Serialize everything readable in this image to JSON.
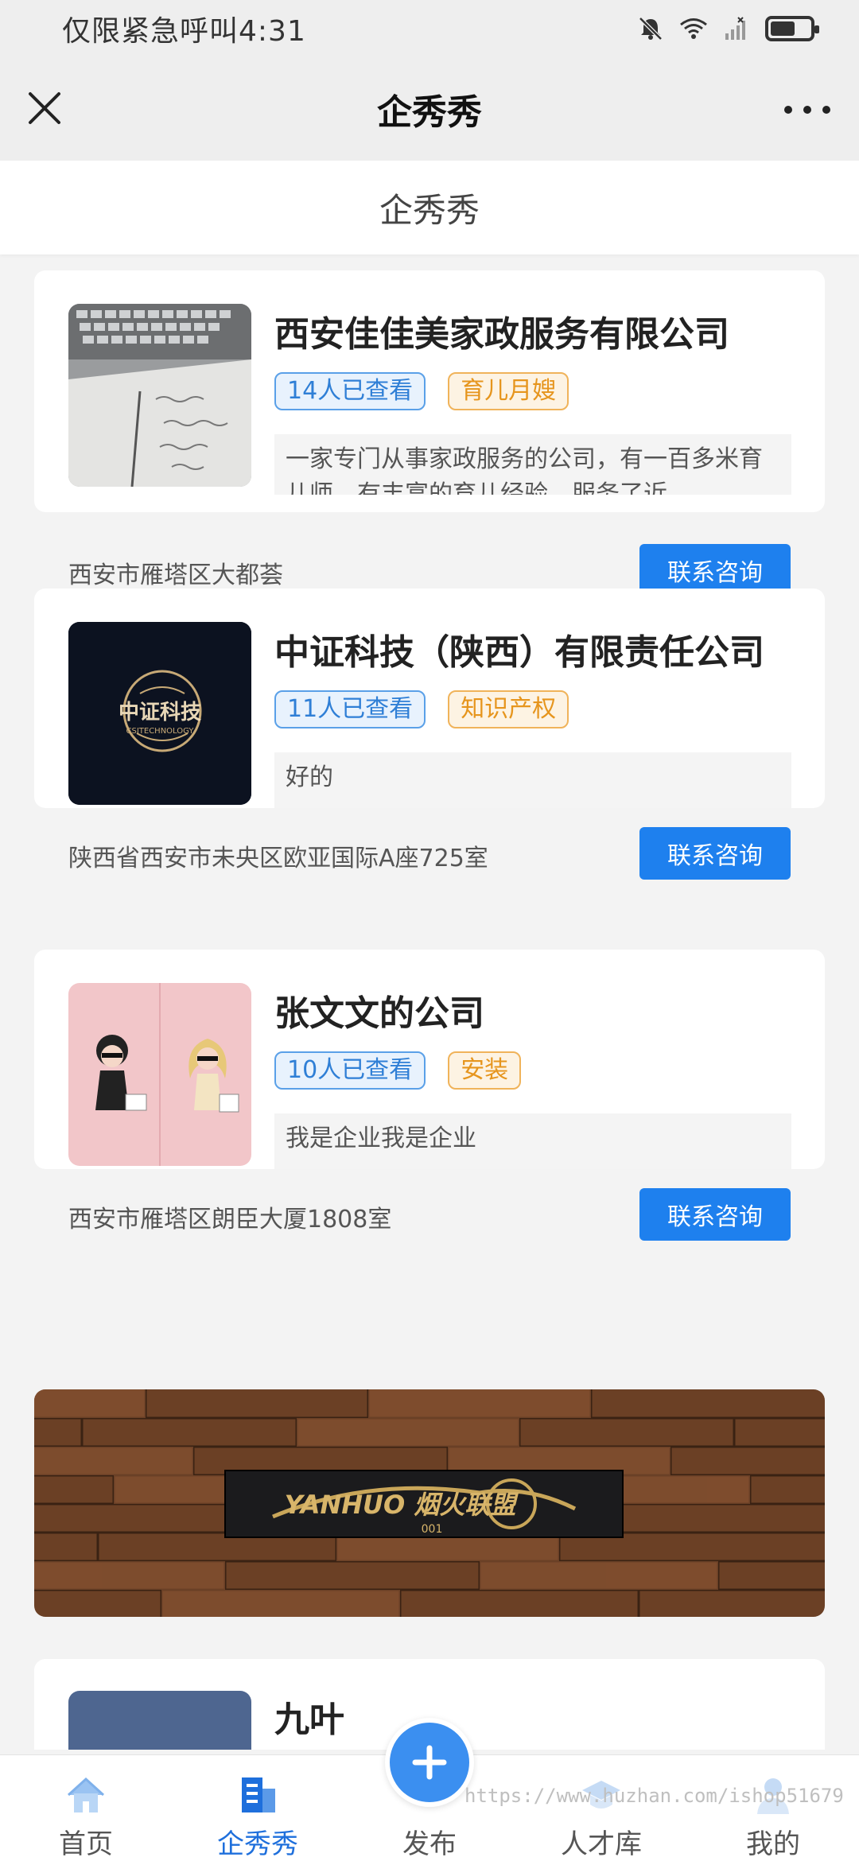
{
  "status_bar": {
    "carrier_time": "仅限紧急呼叫4:31",
    "icons": [
      "bell-off-icon",
      "wifi-icon",
      "signal-icon",
      "battery-icon"
    ]
  },
  "title_bar": {
    "title": "企秀秀",
    "close_icon": "close-icon",
    "more_icon": "more-icon"
  },
  "sub_header": {
    "title": "企秀秀"
  },
  "companies": [
    {
      "name": "西安佳佳美家政服务有限公司",
      "views": "14人已查看",
      "category": "育儿月嫂",
      "description": "一家专门从事家政服务的公司，有一百多米育儿师，有丰富的育儿经验，服务了近…",
      "address": "西安市雁塔区大都荟",
      "button": "联系咨询"
    },
    {
      "name": "中证科技（陕西）有限责任公司",
      "views": "11人已查看",
      "category": "知识产权",
      "description": "好的",
      "address": "陕西省西安市未央区欧亚国际A座725室",
      "button": "联系咨询",
      "logo_text": "中证科技",
      "logo_sub": "CSITECHNOLOGY"
    },
    {
      "name": "张文文的公司",
      "views": "10人已查看",
      "category": "安装",
      "description": "我是企业我是企业",
      "address": "西安市雁塔区朗臣大厦1808室",
      "button": "联系咨询"
    },
    {
      "name": "九叶"
    }
  ],
  "banner": {
    "sign_text": "YANHUO 烟火联盟",
    "sign_sub": "001"
  },
  "bottom_nav": {
    "items": [
      {
        "label": "首页",
        "icon": "home-icon"
      },
      {
        "label": "企秀秀",
        "icon": "building-icon",
        "active": true
      },
      {
        "label": "发布",
        "icon": "plus-icon"
      },
      {
        "label": "人才库",
        "icon": "talent-icon"
      },
      {
        "label": "我的",
        "icon": "user-icon"
      }
    ]
  },
  "watermark": "https://www.huzhan.com/ishop51679",
  "colors": {
    "accent": "#1e80ee",
    "views_tag": "#2f7fd6",
    "category_tag": "#e6951d"
  }
}
